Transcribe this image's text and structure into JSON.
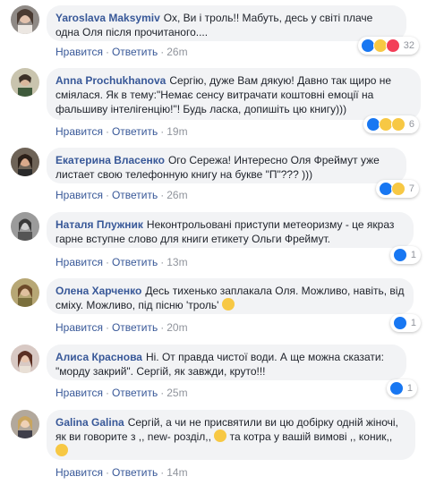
{
  "labels": {
    "like": "Нравится",
    "reply": "Ответить",
    "dot": "·"
  },
  "comments": [
    {
      "author": "Yaroslava Maksymiv",
      "text": "Ох, Ви і троль!! Мабуть, десь у світі плаче одна Оля після прочитаного....",
      "time": "26m",
      "reaction_count": "32",
      "reactions": [
        "like",
        "haha",
        "love"
      ]
    },
    {
      "author": "Anna Prochukhanova",
      "text": "Сергію, дуже Вам дякую! Давно так щиро не сміялася. Як в тему:\"Немає сенсу витрачати коштовні емоції на фальшиву інтелігенцію!\"! Будь ласка, допишіть цю книгу)))",
      "time": "19m",
      "reaction_count": "6",
      "reactions": [
        "like",
        "haha",
        "wow"
      ]
    },
    {
      "author": "Екатерина Власенко",
      "text": "Ого Сережа! Интересно Оля Фреймут уже листает свою телефонную книгу на букве \"П\"??? )))",
      "time": "26m",
      "reaction_count": "7",
      "reactions": [
        "like",
        "haha"
      ]
    },
    {
      "author": "Наталя Плужник",
      "text": "Неконтрольовані приступи метеоризму - це якраз гарне вступне слово для книги етикету Ольги Фреймут.",
      "time": "13m",
      "reaction_count": "1",
      "reactions": [
        "like"
      ]
    },
    {
      "author": "Олена Харченко",
      "text": "Десь тихенько заплакала Оля. Можливо, навіть, від сміху. Можливо, під пісню 'троль'",
      "time": "20m",
      "reaction_count": "1",
      "reactions": [
        "like"
      ]
    },
    {
      "author": "Алиса Краснова",
      "text": "Ні. От правда чистої води. А ще можна сказати: \"морду закрий\". Сергій, як завжди, круто!!!",
      "time": "25m",
      "reaction_count": "1",
      "reactions": [
        "like"
      ]
    },
    {
      "author": "Galina Galina",
      "text_a": "Сергій, а чи не присвятили ви цю добірку одній жіночі, як ви говорите з ,, new- розділ,,",
      "text_b": "та котра у вашій вимові ,, коник,,",
      "time": "14m"
    }
  ],
  "colors": {
    "link": "#385898",
    "bubble": "#f2f3f5",
    "meta": "#90949c",
    "like": "#1877f2"
  }
}
